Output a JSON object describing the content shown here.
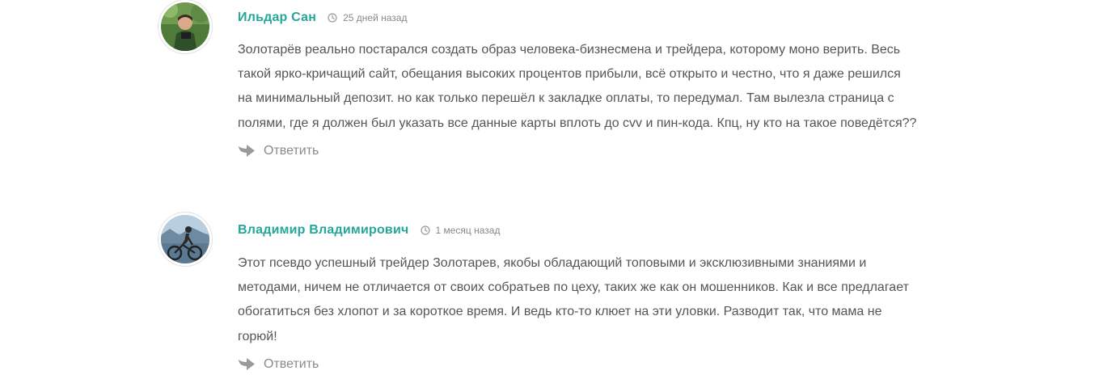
{
  "comments": [
    {
      "author": "Ильдар Сан",
      "date": "25 дней назад",
      "text": "Золотарёв реально постарался создать образ человека-бизнесмена и трейдера, которому моно верить. Весь такой ярко-кричащий сайт, обещания высоких процентов прибыли, всё открыто и честно, что я даже решился на минимальный депозит. но как только перешёл к закладке оплаты, то передумал. Там вылезла страница с полями, где я должен был указать все данные карты вплоть до cvv и пин-кода. Кпц, ну кто на такое поведётся??",
      "reply_label": "Ответить"
    },
    {
      "author": "Владимир Владимирович",
      "date": "1 месяц назад",
      "text": "Этот псевдо успешный трейдер Золотарев, якобы обладающий топовыми и эксклюзивными знаниями и методами, ничем не отличается от своих собратьев по цеху, таких же как он мошенников. Как и все предлагает обогатиться без хлопот и за короткое время. И ведь кто-то клюет на эти уловки. Разводит так, что мама не горюй!",
      "reply_label": "Ответить"
    }
  ],
  "colors": {
    "author": "#26a69a",
    "text": "#555555",
    "meta": "#888888"
  },
  "icons": {
    "date": "clock-icon",
    "reply": "reply-arrow-icon"
  }
}
